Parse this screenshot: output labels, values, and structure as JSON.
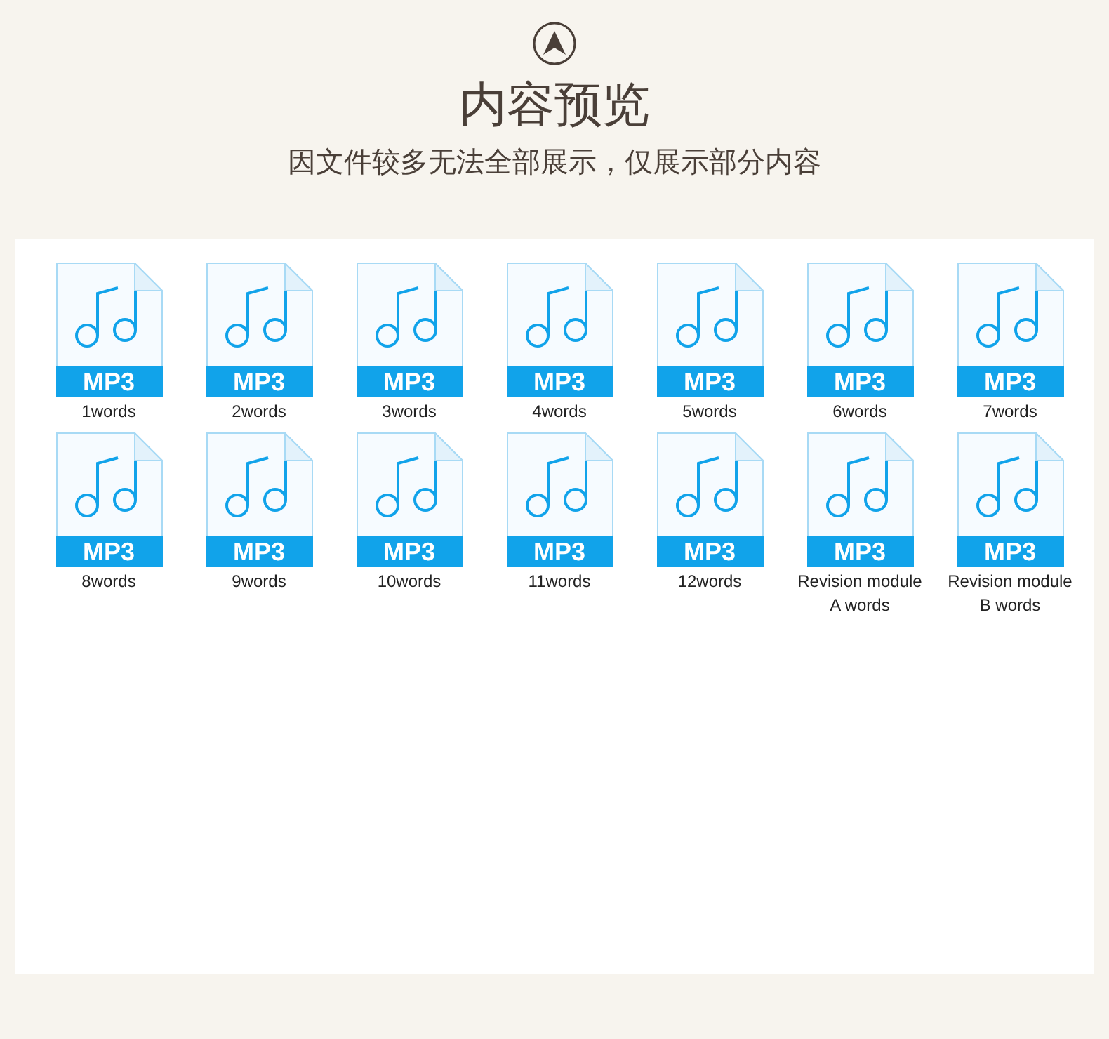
{
  "header": {
    "title": "内容预览",
    "subtitle": "因文件较多无法全部展示，仅展示部分内容"
  },
  "files": [
    {
      "type": "MP3",
      "name": "1words"
    },
    {
      "type": "MP3",
      "name": "2words"
    },
    {
      "type": "MP3",
      "name": "3words"
    },
    {
      "type": "MP3",
      "name": "4words"
    },
    {
      "type": "MP3",
      "name": "5words"
    },
    {
      "type": "MP3",
      "name": "6words"
    },
    {
      "type": "MP3",
      "name": "7words"
    },
    {
      "type": "MP3",
      "name": "8words"
    },
    {
      "type": "MP3",
      "name": "9words"
    },
    {
      "type": "MP3",
      "name": "10words"
    },
    {
      "type": "MP3",
      "name": "11words"
    },
    {
      "type": "MP3",
      "name": "12words"
    },
    {
      "type": "MP3",
      "name": "Revision module A words"
    },
    {
      "type": "MP3",
      "name": "Revision module B words"
    }
  ]
}
